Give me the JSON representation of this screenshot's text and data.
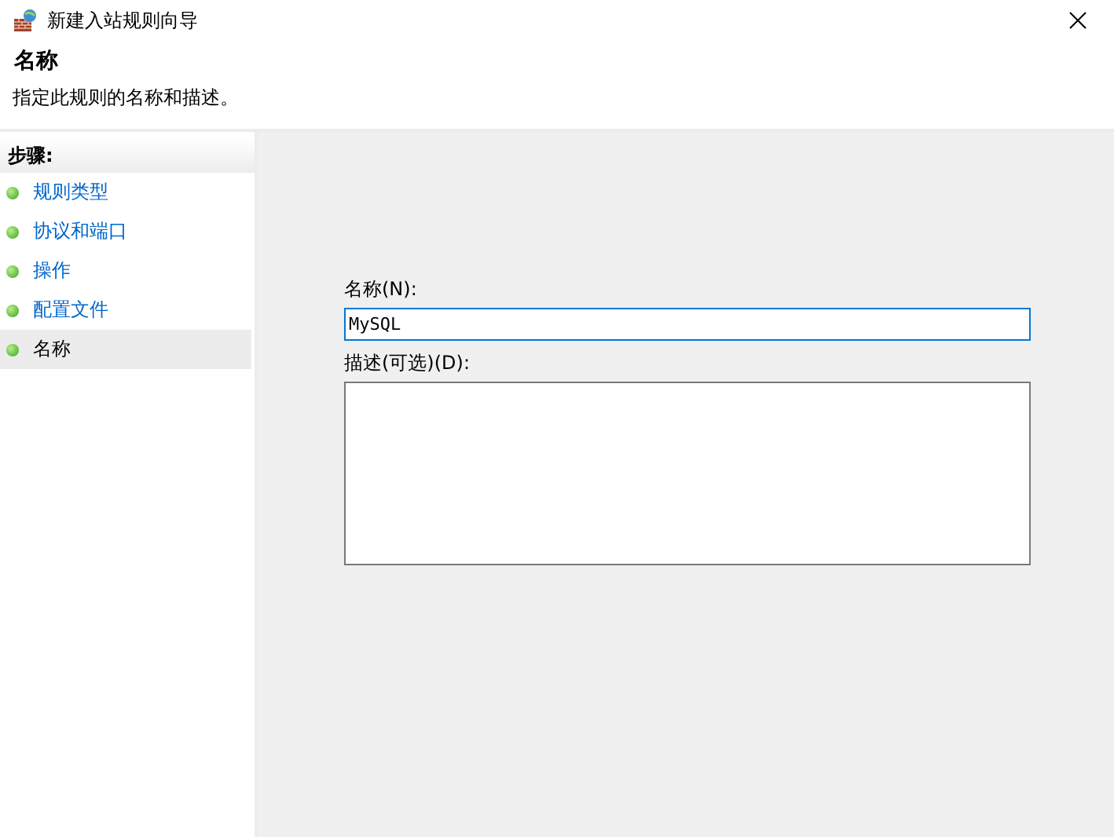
{
  "window": {
    "title": "新建入站规则向导"
  },
  "header": {
    "title": "名称",
    "description": "指定此规则的名称和描述。"
  },
  "steps": {
    "heading": "步骤:",
    "items": [
      {
        "label": "规则类型",
        "selected": false
      },
      {
        "label": "协议和端口",
        "selected": false
      },
      {
        "label": "操作",
        "selected": false
      },
      {
        "label": "配置文件",
        "selected": false
      },
      {
        "label": "名称",
        "selected": true
      }
    ]
  },
  "form": {
    "name_label": "名称(N):",
    "name_value": "MySQL",
    "description_label": "描述(可选)(D):"
  }
}
